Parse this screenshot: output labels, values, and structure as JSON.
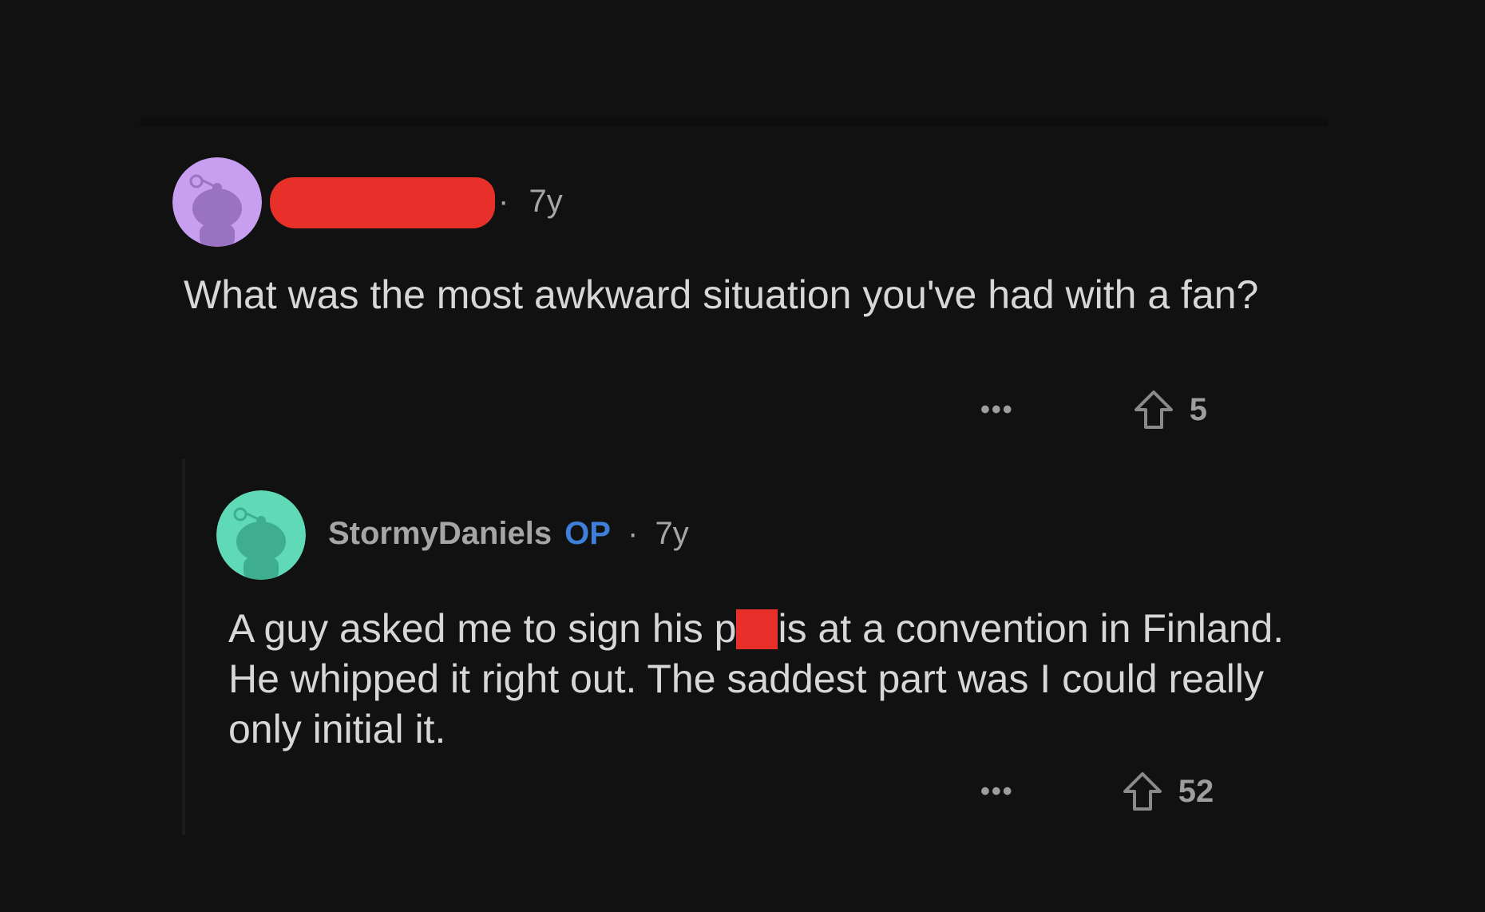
{
  "post": {
    "age": "7y",
    "separator": "·",
    "body": "What was the most awkward situation you've had with a fan?",
    "more_label": "•••",
    "vote_count": "5",
    "avatar_color": "#c89ef0"
  },
  "reply": {
    "username": "StormyDaniels",
    "op_badge": "OP",
    "age": "7y",
    "separator": "·",
    "body_before_censor": "A guy asked me to sign his p",
    "body_after_censor": "is at a convention in Finland. He whipped it right out. The saddest part was I could really only initial it.",
    "more_label": "•••",
    "vote_count": "52",
    "avatar_color": "#5fd9b6"
  },
  "colors": {
    "background": "#111112",
    "redaction": "#e8302a",
    "op_badge": "#3d7fd9"
  },
  "icons": {
    "avatar": "snoo-avatar-icon",
    "upvote": "upvote-arrow-icon",
    "more": "more-options-icon"
  }
}
